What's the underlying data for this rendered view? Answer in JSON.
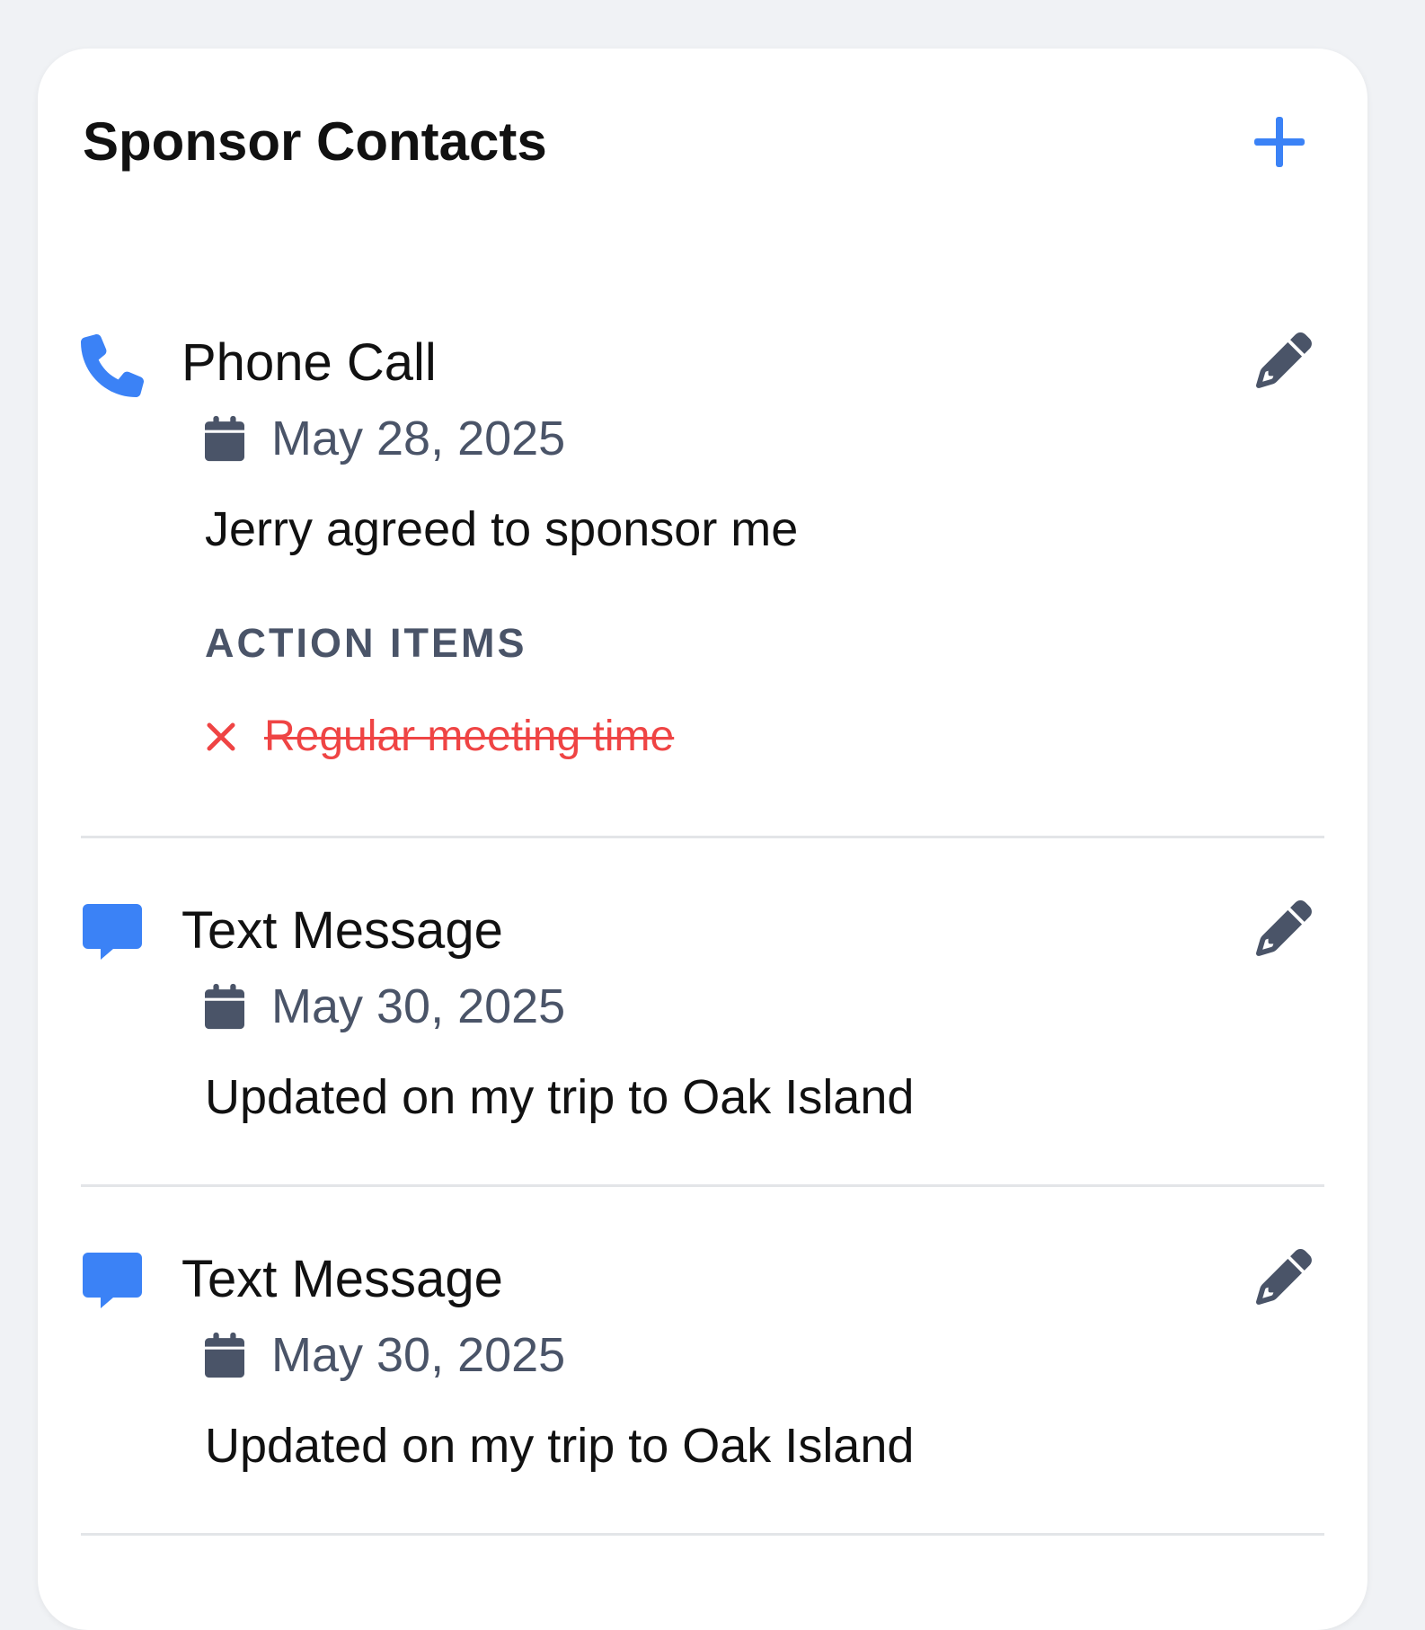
{
  "panel": {
    "title": "Sponsor Contacts",
    "add_icon": "plus-icon",
    "accent_color": "#3b82f6"
  },
  "contacts": [
    {
      "type": "Phone Call",
      "icon": "phone-icon",
      "date": "May 28, 2025",
      "note": "Jerry agreed to sponsor me",
      "action_items_label": "ACTION ITEMS",
      "action_items": [
        {
          "text": "Regular meeting time",
          "status": "cancelled",
          "icon": "x-icon",
          "color": "#ef4444"
        }
      ]
    },
    {
      "type": "Text Message",
      "icon": "message-icon",
      "date": "May 30, 2025",
      "note": "Updated on my trip to Oak Island"
    },
    {
      "type": "Text Message",
      "icon": "message-icon",
      "date": "May 30, 2025",
      "note": "Updated on my trip to Oak Island"
    }
  ]
}
